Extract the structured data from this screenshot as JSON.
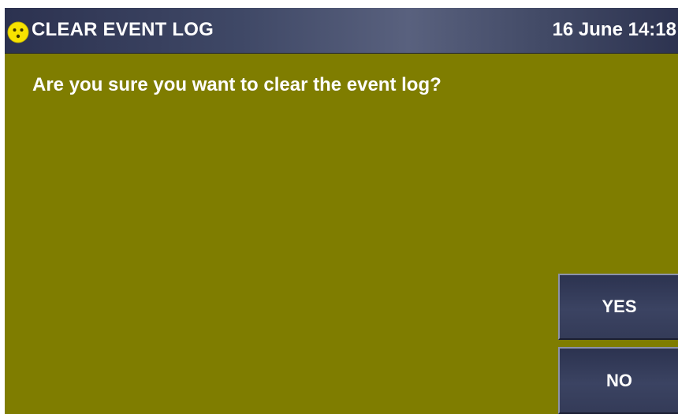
{
  "header": {
    "status_icon": "smiley-face-icon",
    "title": "CLEAR EVENT LOG",
    "datetime": "16 June 14:18"
  },
  "dialog": {
    "prompt": "Are you sure you want to clear the event log?"
  },
  "buttons": {
    "yes_label": "YES",
    "no_label": "NO"
  },
  "colors": {
    "background": "#7f7d00",
    "header": "#3f4866",
    "button": "#363d5a",
    "text": "#ffffff",
    "icon": "#f7e300"
  }
}
